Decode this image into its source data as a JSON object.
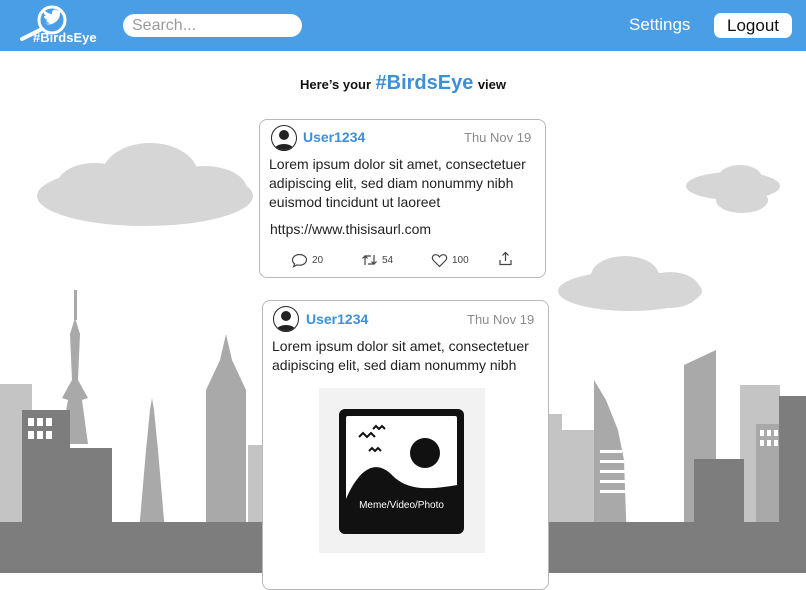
{
  "header": {
    "logo_text": "#BirdsEye",
    "search_placeholder": "Search...",
    "settings_label": "Settings",
    "logout_label": "Logout"
  },
  "feed": {
    "heading_prefix": "Here’s your",
    "heading_brand": "#BirdsEye",
    "heading_suffix": "view",
    "posts": [
      {
        "username": "User1234",
        "date": "Thu Nov 19",
        "text_lines": [
          "Lorem ipsum dolor sit amet, consectetuer",
          "adipiscing elit, sed diam nonummy nibh",
          "euismod tincidunt ut laoreet"
        ],
        "link": "https://www.thisisaurl.com",
        "comments": "20",
        "retweets": "54",
        "likes": "100"
      },
      {
        "username": "User1234",
        "date": "Thu Nov 19",
        "text_lines": [
          "Lorem ipsum dolor sit amet, consectetuer",
          "adipiscing elit, sed diam nonummy nibh"
        ],
        "media_label": "Meme/Video/Photo"
      }
    ]
  },
  "colors": {
    "header_bg": "#4a9ee6",
    "brand_blue": "#3d8fd9",
    "skyline_dark": "#7d7d7d",
    "skyline_mid": "#a9a9a9",
    "skyline_light": "#c4c4c4",
    "cloud": "#d6d6d6"
  },
  "icons": [
    "search-logo-icon",
    "bird-icon",
    "comment-icon",
    "retweet-icon",
    "heart-icon",
    "share-icon",
    "user-avatar-icon",
    "image-placeholder-icon"
  ]
}
